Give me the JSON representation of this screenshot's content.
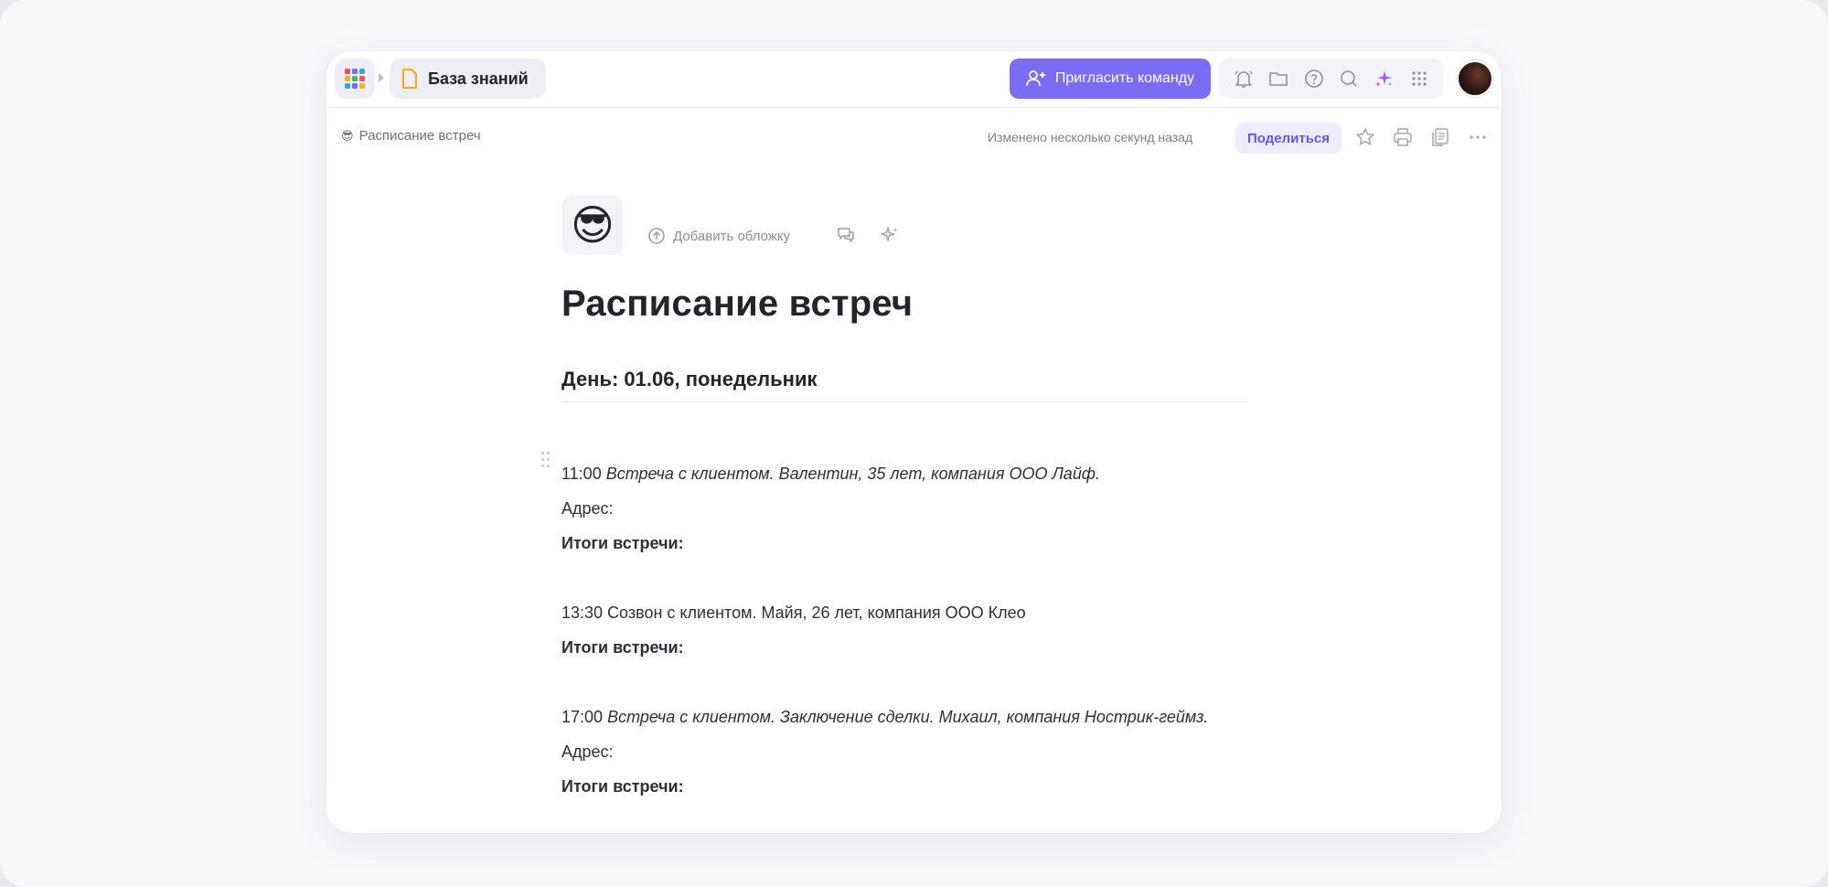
{
  "app": {
    "knowledge_base_label": "База знаний",
    "invite_label": "Пригласить команду",
    "apps_colors": [
      "#f04f5b",
      "#7b6cf6",
      "#3aa0ff",
      "#ffb020",
      "#2ec27e",
      "#f04f5b",
      "#3aa0ff",
      "#7b6cf6",
      "#ffb020"
    ],
    "accent_color": "#7b6cf6",
    "tools": [
      "bell-icon",
      "folder-icon",
      "help-icon",
      "search-icon",
      "ai-sparkle-icon",
      "grid-icon"
    ]
  },
  "doc_bar": {
    "breadcrumb_emoji": "😎",
    "breadcrumb_title": "Расписание встреч",
    "changed_text": "Изменено несколько секунд назад",
    "share_label": "Поделиться",
    "tools": [
      "star-icon",
      "print-icon",
      "copy-icon",
      "more-icon"
    ]
  },
  "document": {
    "emoji": "😎",
    "add_cover_label": "Добавить обложку",
    "title": "Расписание встреч",
    "day_heading": "День: 01.06, понедельник",
    "entries": [
      {
        "time": "11:00",
        "description": "Встреча с клиентом. Валентин, 35 лет, компания ООО Лайф.",
        "italic": true,
        "address_label": "Адрес:",
        "summary_label": "Итоги встречи:"
      },
      {
        "time": "13:30",
        "description": "Созвон с клиентом. Майя, 26 лет, компания ООО Клео",
        "italic": false,
        "summary_label": "Итоги встречи:"
      },
      {
        "time": "17:00",
        "description": "Встреча с клиентом. Заключение сделки. Михаил, компания Нострик-геймз.",
        "italic": true,
        "address_label": "Адрес:",
        "summary_label": "Итоги встречи:"
      }
    ]
  }
}
